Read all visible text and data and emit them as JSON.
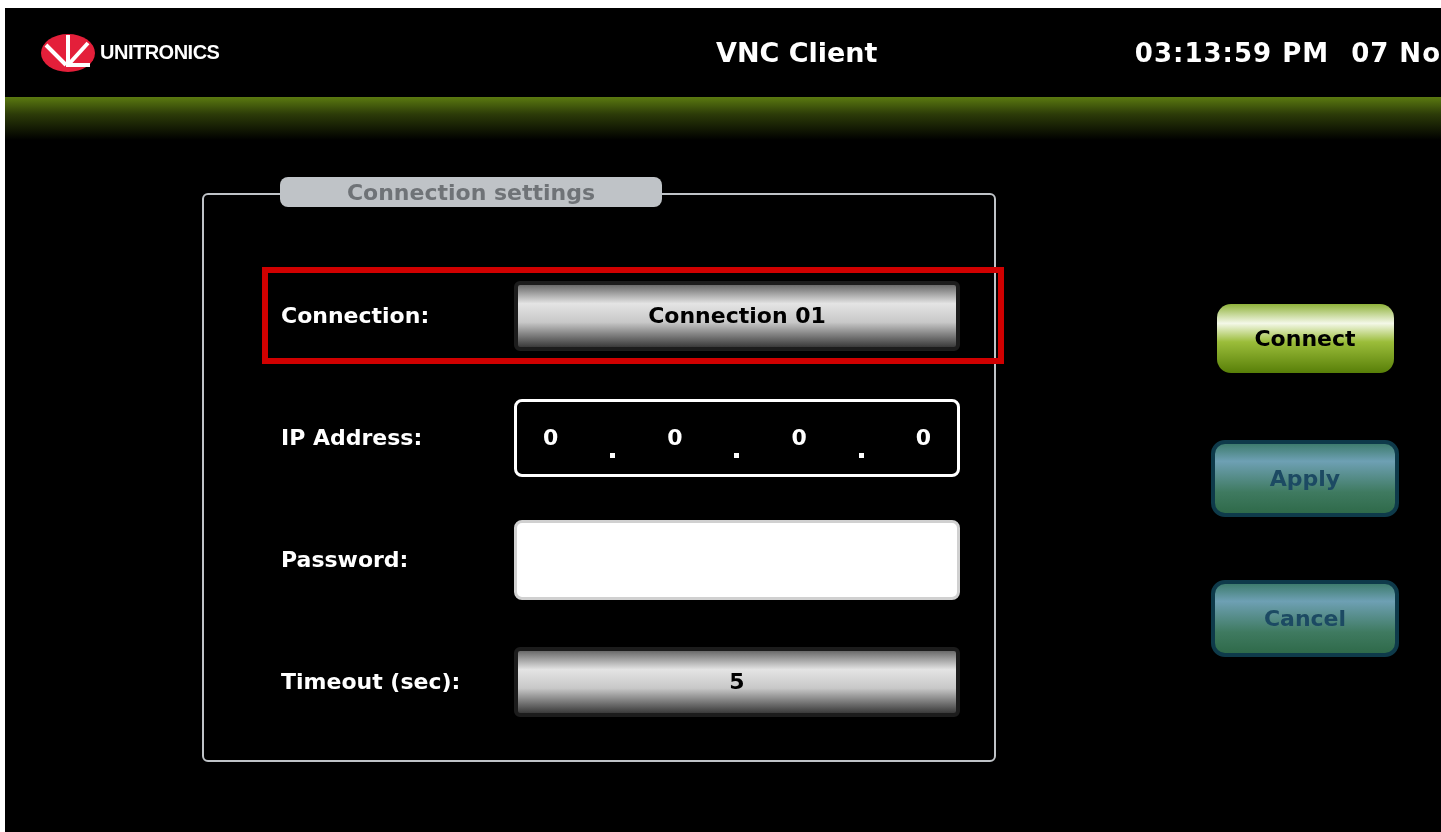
{
  "header": {
    "logo_text": "UNITRONICS",
    "title": "VNC Client",
    "time": "03:13:59 PM",
    "date": "07 No"
  },
  "settings": {
    "legend": "Connection settings",
    "rows": [
      {
        "label": "Connection:",
        "kind": "select",
        "value": "Connection 01",
        "highlighted": true
      },
      {
        "label": "IP Address:",
        "kind": "ip",
        "octets": [
          "0",
          "0",
          "0",
          "0"
        ],
        "highlighted": false
      },
      {
        "label": "Password:",
        "kind": "password",
        "highlighted": false
      },
      {
        "label": "Timeout (sec):",
        "kind": "select",
        "value": "5",
        "highlighted": false
      }
    ]
  },
  "buttons": [
    {
      "label": "Connect",
      "kind": "primary"
    },
    {
      "label": "Apply",
      "kind": "secondary"
    },
    {
      "label": "Cancel",
      "kind": "secondary"
    }
  ]
}
